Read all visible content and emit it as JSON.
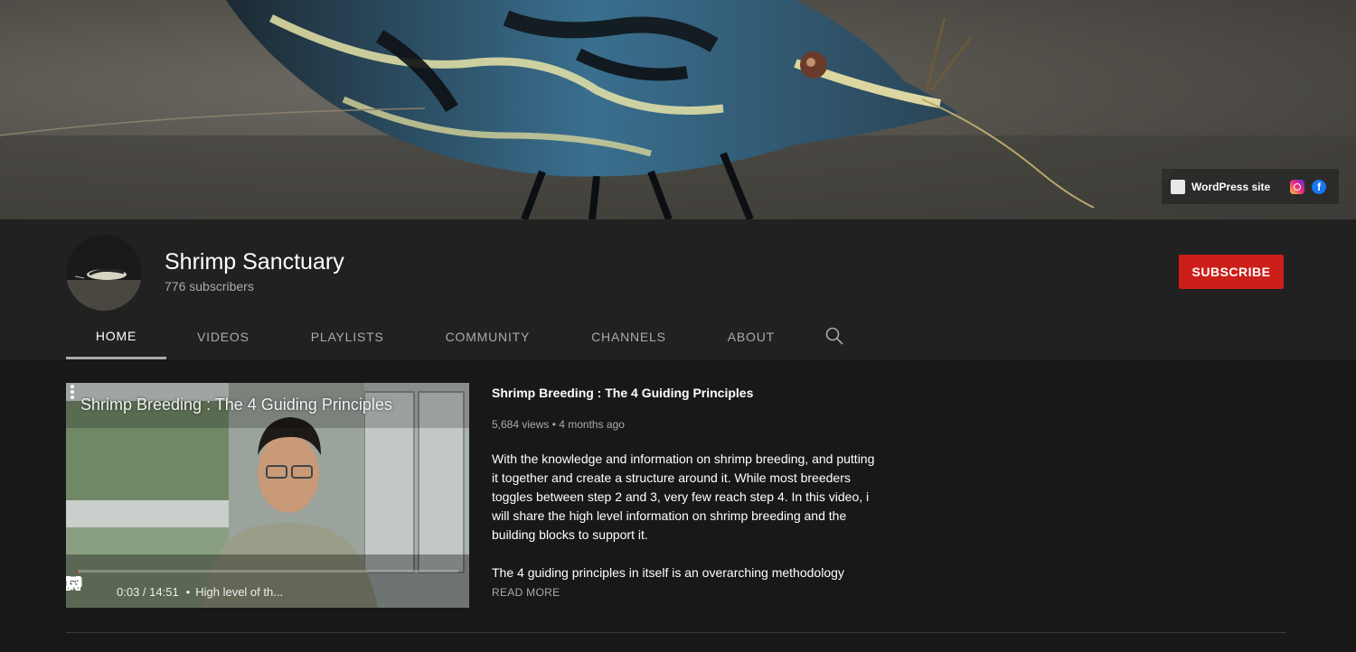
{
  "banner": {
    "links": [
      {
        "label": "WordPress site",
        "icon": "wordpress-icon"
      },
      {
        "label": "",
        "icon": "instagram-icon"
      },
      {
        "label": "",
        "icon": "facebook-icon"
      }
    ]
  },
  "channel": {
    "title": "Shrimp Sanctuary",
    "subscribers": "776 subscribers",
    "subscribe_label": "SUBSCRIBE",
    "subscribe_color": "#cc1f1a"
  },
  "tabs": [
    {
      "label": "HOME",
      "active": true
    },
    {
      "label": "VIDEOS",
      "active": false
    },
    {
      "label": "PLAYLISTS",
      "active": false
    },
    {
      "label": "COMMUNITY",
      "active": false
    },
    {
      "label": "CHANNELS",
      "active": false
    },
    {
      "label": "ABOUT",
      "active": false
    }
  ],
  "featured": {
    "player_title": "Shrimp Breeding : The 4 Guiding Principles",
    "progress_percent": 0.3,
    "time": "0:03 / 14:51",
    "chapter": "High level of th...",
    "title": "Shrimp Breeding : The 4 Guiding Principles",
    "meta": "5,684 views • 4 months ago",
    "description": "With the knowledge and information on shrimp breeding, and putting it together and create a structure around it. While most breeders toggles between step 2 and 3, very few reach step 4. In this video, i will share the high level information on shrimp breeding and the building blocks to support it.",
    "description_more": "The 4 guiding principles in itself is an overarching methodology",
    "read_more_label": "READ MORE"
  },
  "colors": {
    "background": "#181818",
    "header": "#212121",
    "progress": "#ff0000"
  }
}
